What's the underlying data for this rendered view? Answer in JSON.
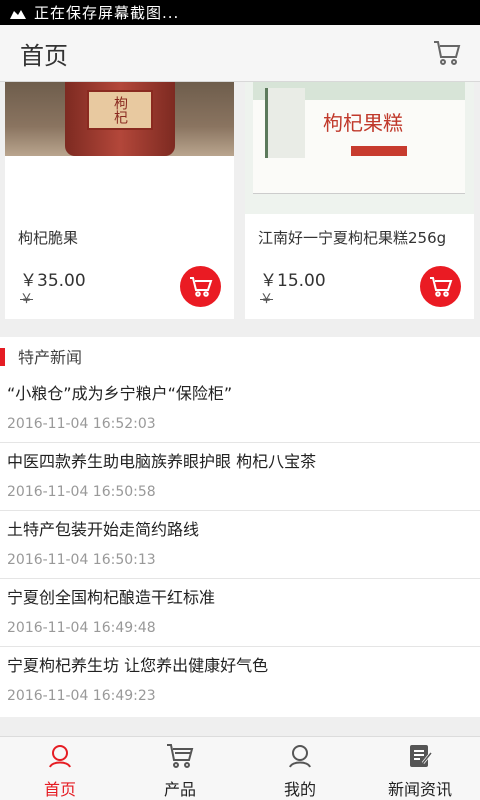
{
  "status_bar": {
    "text": "正在保存屏幕截图..."
  },
  "header": {
    "title": "首页"
  },
  "products": [
    {
      "name": "枸杞脆果",
      "price": "￥35.00",
      "old_price": "￥",
      "label": "枸杞"
    },
    {
      "name": "江南好一宁夏枸杞果糕256g",
      "price": "￥15.00",
      "old_price": "￥",
      "label": "枸杞果糕"
    }
  ],
  "news": {
    "section_title": "特产新闻",
    "items": [
      {
        "title": "“小粮仓”成为乡宁粮户“保险柜”",
        "time": "2016-11-04 16:52:03"
      },
      {
        "title": "中医四款养生助电脑族养眼护眼 枸杞八宝茶",
        "time": "2016-11-04 16:50:58"
      },
      {
        "title": "土特产包装开始走简约路线",
        "time": "2016-11-04 16:50:13"
      },
      {
        "title": "宁夏创全国枸杞酿造干红标准",
        "time": "2016-11-04 16:49:48"
      },
      {
        "title": "宁夏枸杞养生坊 让您养出健康好气色",
        "time": "2016-11-04 16:49:23"
      }
    ]
  },
  "nav": [
    {
      "label": "首页",
      "icon": "home-icon",
      "active": true
    },
    {
      "label": "产品",
      "icon": "cart-icon",
      "active": false
    },
    {
      "label": "我的",
      "icon": "user-icon",
      "active": false
    },
    {
      "label": "新闻资讯",
      "icon": "news-icon",
      "active": false
    }
  ],
  "colors": {
    "accent": "#e51c23",
    "cart_button": "#ea1b23"
  }
}
